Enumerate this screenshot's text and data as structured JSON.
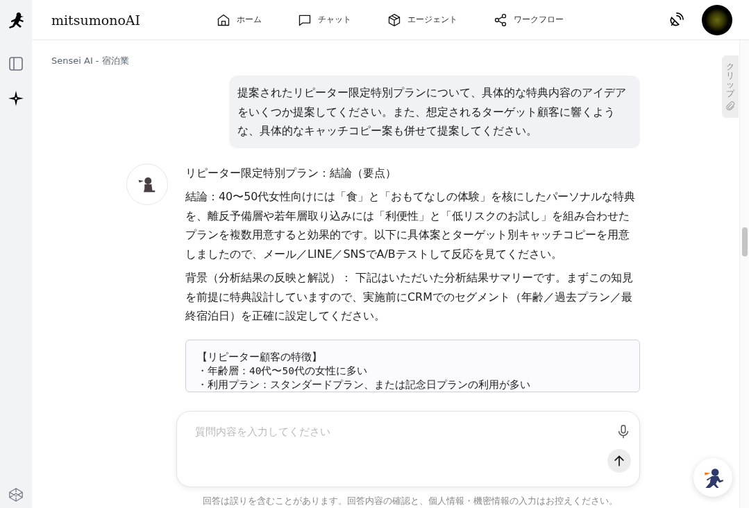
{
  "header": {
    "brand": "mitsumonoAI",
    "nav": [
      {
        "label": "ホーム",
        "selected": false
      },
      {
        "label": "チャット",
        "selected": false
      },
      {
        "label": "エージェント",
        "selected": false
      },
      {
        "label": "ワークフロー",
        "selected": false
      }
    ]
  },
  "breadcrumb": "Sensei AI - 宿泊業",
  "clip_tab": "クリップ",
  "messages": [
    {
      "kind": "user",
      "text": "提案されたリピーター限定特別プランについて、具体的な特典内容のアイデアをいくつか提案してください。また、想定されるターゲット顧客に響くような、具体的なキャッチコピー案も併せて提案してください。"
    },
    {
      "kind": "assistant",
      "paragraphs": [
        "リピーター限定特別プラン：結論（要点）",
        "結論：40〜50代女性向けには「食」と「おもてなしの体験」を核にしたパーソナルな特典を、離反予備層や若年層取り込みには「利便性」と「低リスクのお試し」を組み合わせたプランを複数用意すると効果的です。以下に具体案とターゲット別キャッチコピーを用意しましたので、メール／LINE／SNSでA/Bテストして反応を見てください。",
        "背景（分析結果の反映と解説）： 下記はいただいた分析結果サマリーです。まずこの知見を前提に特典設計していますので、実施前にCRMでのセグメント（年齢／過去プラン／最終宿泊日）を正確に設定してください。"
      ],
      "code_lines": [
        "【リピーター顧客の特徴】",
        "・年齢層：40代〜50代の女性に多い",
        "・利用プラン：スタンダードプラン、または記念日プランの利用が多い"
      ]
    }
  ],
  "composer": {
    "placeholder": "質問内容を入力してください"
  },
  "disclaimer": "回答は誤りを含むことがあります。回答内容の確認と、個人情報・機密情報の入力はお控えください。"
}
